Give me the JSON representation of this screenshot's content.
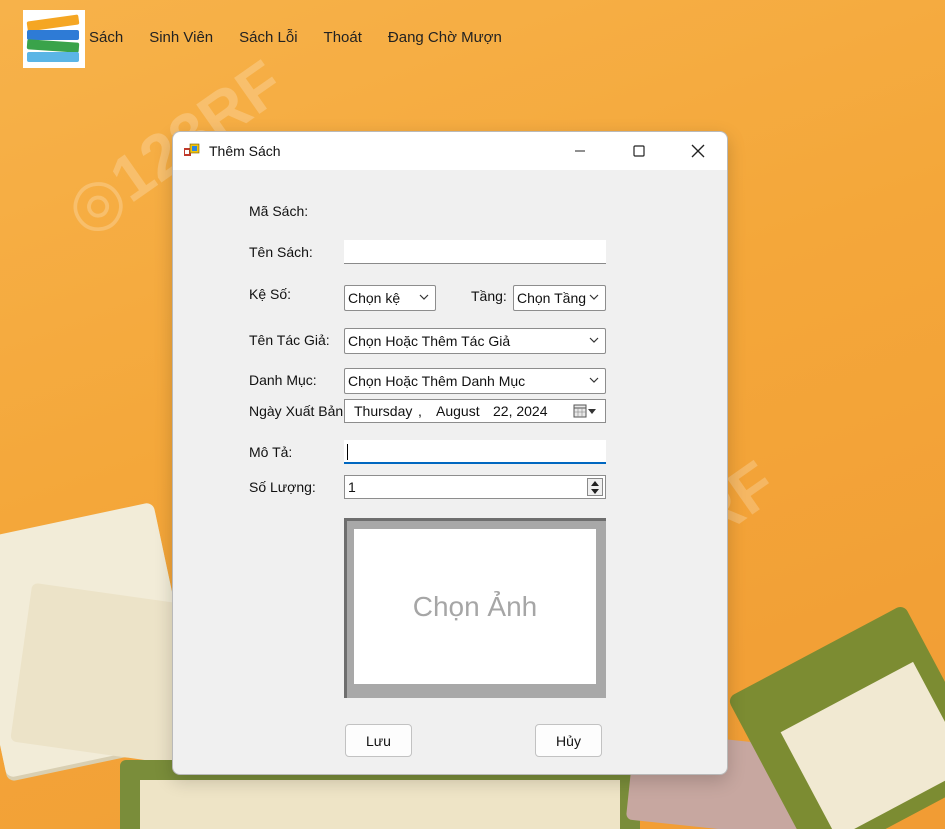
{
  "menu": {
    "items": [
      "Sách",
      "Sinh Viên",
      "Sách Lỗi",
      "Thoát",
      "Đang Chờ Mượn"
    ]
  },
  "dialog": {
    "title": "Thêm Sách",
    "labels": {
      "ma_sach": "Mã Sách:",
      "ten_sach": "Tên Sách:",
      "ke_so": "Kệ Số:",
      "tang": "Tầng:",
      "ten_tac_gia": "Tên Tác Giả:",
      "danh_muc": "Danh Mục:",
      "ngay_xuat_ban": "Ngày Xuất Bản:",
      "mo_ta": "Mô Tả:",
      "so_luong": "Số Lượng:"
    },
    "fields": {
      "ten_sach": "",
      "ke_so": "Chọn kệ",
      "tang": "Chọn Tầng",
      "ten_tac_gia": "Chọn Hoặc Thêm Tác Giả",
      "danh_muc": "Chọn Hoặc Thêm Danh Mục",
      "date_weekday": "Thursday",
      "date_sep": ",",
      "date_month": "August",
      "date_day_year": "22, 2024",
      "mo_ta": "",
      "so_luong": "1"
    },
    "picture_placeholder": "Chọn Ảnh",
    "buttons": {
      "save": "Lưu",
      "cancel": "Hủy"
    }
  },
  "colors": {
    "background": "#f4a73a",
    "dialog_bg": "#f0f0f0",
    "focus_accent": "#0067c0"
  }
}
